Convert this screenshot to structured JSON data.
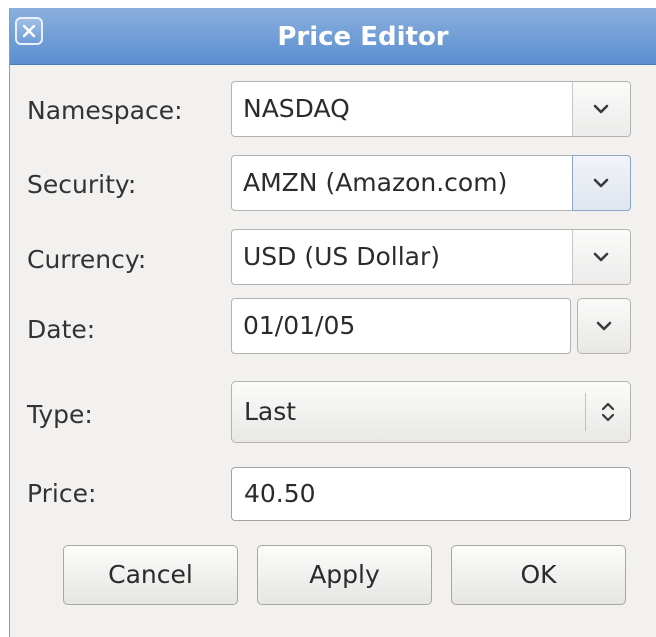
{
  "window": {
    "title": "Price Editor",
    "accent": "#5b8ed0"
  },
  "fields": {
    "namespace": {
      "label": "Namespace:",
      "value": "NASDAQ"
    },
    "security": {
      "label": "Security:",
      "value": "AMZN (Amazon.com)"
    },
    "currency": {
      "label": "Currency:",
      "value": "USD (US Dollar)"
    },
    "date": {
      "label": "Date:",
      "value": "01/01/05"
    },
    "type": {
      "label": "Type:",
      "value": "Last"
    },
    "price": {
      "label": "Price:",
      "value": "40.50"
    }
  },
  "buttons": {
    "cancel": "Cancel",
    "apply": "Apply",
    "ok": "OK"
  },
  "icons": {
    "close": "close-icon",
    "dropdown": "chevron-down-icon",
    "spin": "up-down-chevron-icon"
  }
}
